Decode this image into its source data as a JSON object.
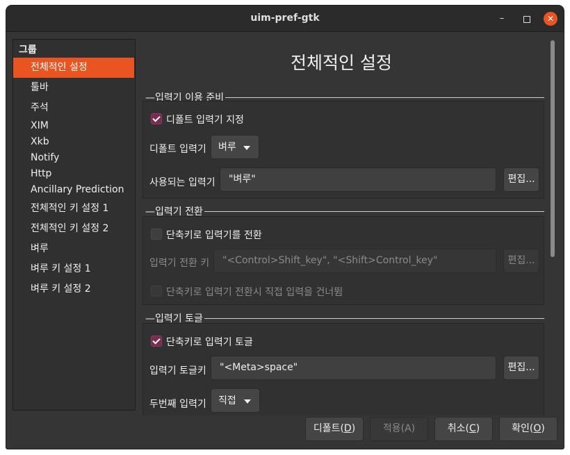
{
  "window": {
    "title": "uim-pref-gtk",
    "minimize_glyph": "–",
    "close_glyph": "✕"
  },
  "sidebar": {
    "group_title": "그룹",
    "items": [
      {
        "label": "전체적인 설정",
        "selected": true
      },
      {
        "label": "툴바",
        "selected": false
      },
      {
        "label": "주석",
        "selected": false
      },
      {
        "label": "XIM",
        "selected": false
      },
      {
        "label": "Xkb",
        "selected": false
      },
      {
        "label": "Notify",
        "selected": false
      },
      {
        "label": "Http",
        "selected": false
      },
      {
        "label": "Ancillary Prediction",
        "selected": false
      },
      {
        "label": "전체적인 키 설정 1",
        "selected": false
      },
      {
        "label": "전체적인 키 설정 2",
        "selected": false
      },
      {
        "label": "벼루",
        "selected": false
      },
      {
        "label": "벼루 키 설정 1",
        "selected": false
      },
      {
        "label": "벼루 키 설정 2",
        "selected": false
      }
    ]
  },
  "main": {
    "title": "전체적인 설정",
    "section_prepare": {
      "label": "입력기 이용 준비",
      "default_im_check": {
        "label": "디폴트 입력기 지정",
        "checked": true
      },
      "default_im_label": "디폴트 입력기",
      "default_im_value": "벼루",
      "used_im_label": "사용되는 입력기",
      "used_im_value": "\"벼루\"",
      "edit_label": "편집..."
    },
    "section_switch": {
      "label": "입력기 전환",
      "switch_check": {
        "label": "단축키로 입력기를 전환",
        "checked": false
      },
      "switch_key_label": "입력기 전환 키",
      "switch_key_value": "\"<Control>Shift_key\", \"<Shift>Control_key\"",
      "edit_label": "편집...",
      "skip_check": {
        "label": "단축키로 입력기 전환시 직접 입력을 건너뜀",
        "checked": false
      }
    },
    "section_toggle": {
      "label": "입력기 토글",
      "toggle_check": {
        "label": "단축키로 입력기 토글",
        "checked": true
      },
      "toggle_key_label": "입력기 토글키",
      "toggle_key_value": "\"<Meta>space\"",
      "edit_label": "편집...",
      "second_im_label": "두번째 입력기",
      "second_im_value": "직접"
    }
  },
  "buttons": {
    "defaults": {
      "text": "디폴트(",
      "mnemonic": "D",
      "end": ")"
    },
    "apply": "적용(A)",
    "cancel": {
      "text": "취소(",
      "mnemonic": "C",
      "end": ")"
    },
    "ok": {
      "text": "확인(",
      "mnemonic": "O",
      "end": ")"
    }
  },
  "colors": {
    "accent": "#e95420",
    "checkbox_checked": "#7a2b52",
    "background": "#353535"
  }
}
